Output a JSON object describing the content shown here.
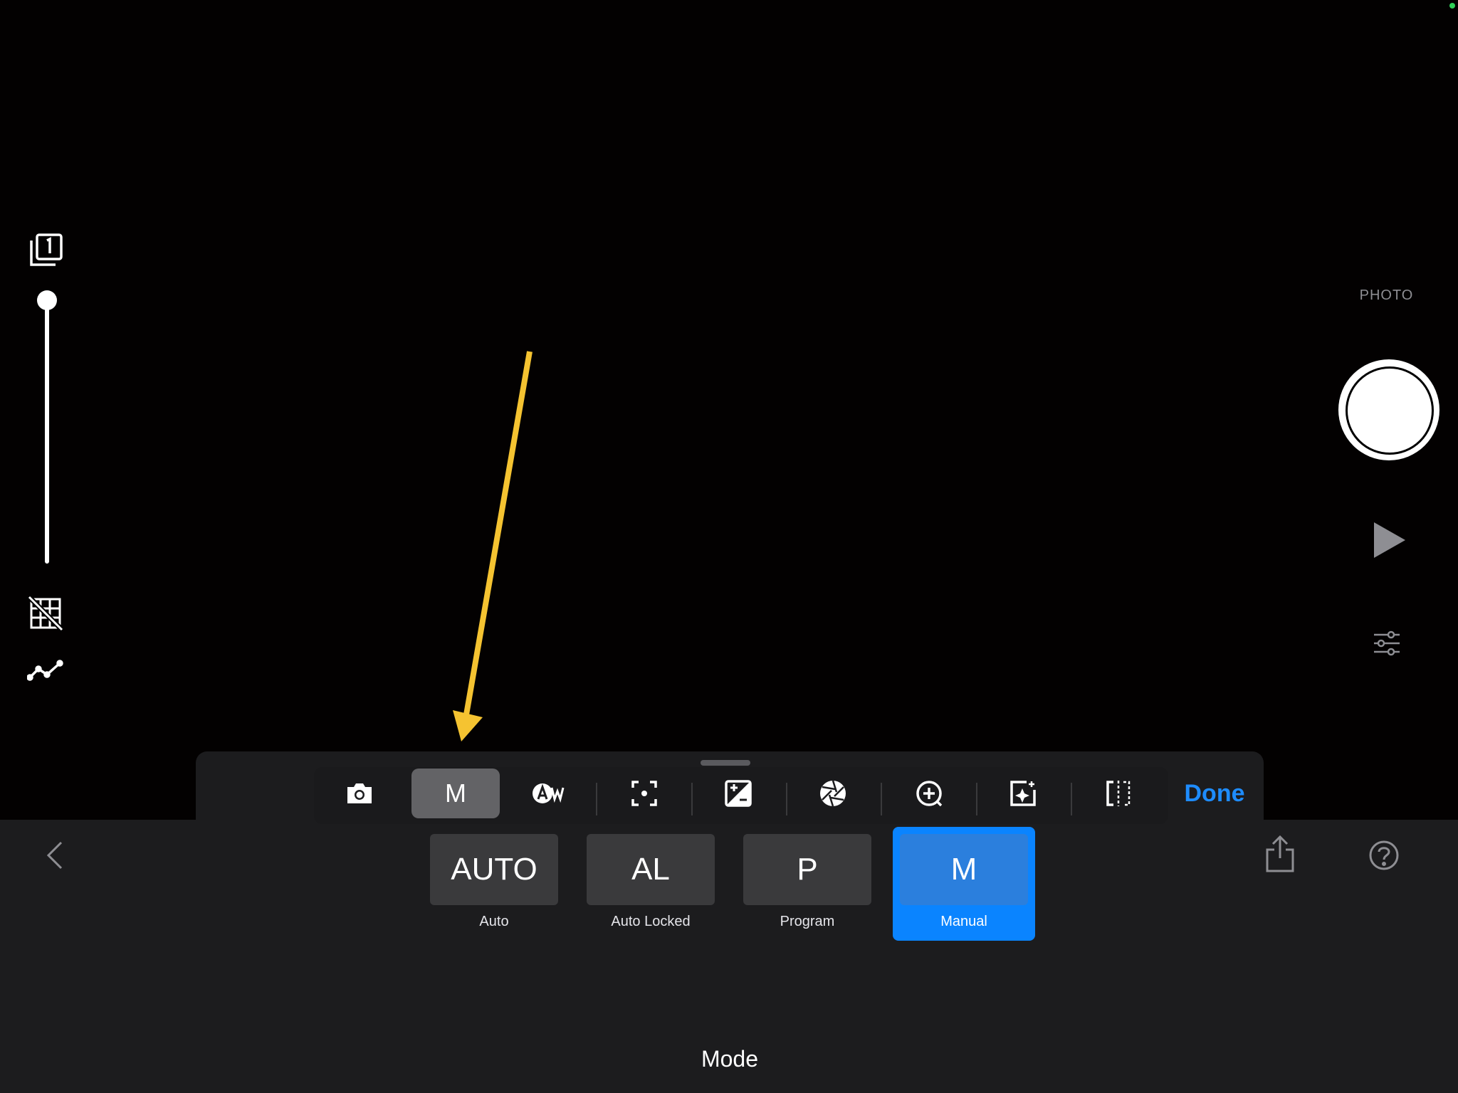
{
  "camera": {
    "capture_mode_label": "PHOTO",
    "zoom_level": 0.0
  },
  "panel": {
    "done_label": "Done",
    "title": "Mode",
    "tools": [
      {
        "name": "camera-icon"
      },
      {
        "name": "mode",
        "letter": "M",
        "selected": true
      },
      {
        "name": "auto-white-balance-icon"
      },
      {
        "name": "focus-icon"
      },
      {
        "name": "exposure-compensation-icon"
      },
      {
        "name": "aperture-icon"
      },
      {
        "name": "zoom-icon"
      },
      {
        "name": "enhance-icon"
      },
      {
        "name": "mirror-icon"
      }
    ],
    "modes": [
      {
        "symbol": "AUTO",
        "label": "Auto",
        "selected": false
      },
      {
        "symbol": "AL",
        "label": "Auto Locked",
        "selected": false
      },
      {
        "symbol": "P",
        "label": "Program",
        "selected": false
      },
      {
        "symbol": "M",
        "label": "Manual",
        "selected": true
      }
    ]
  },
  "colors": {
    "accent": "#0a84ff",
    "annotation_arrow": "#f5c331",
    "panel_bg": "#1c1c1e"
  }
}
